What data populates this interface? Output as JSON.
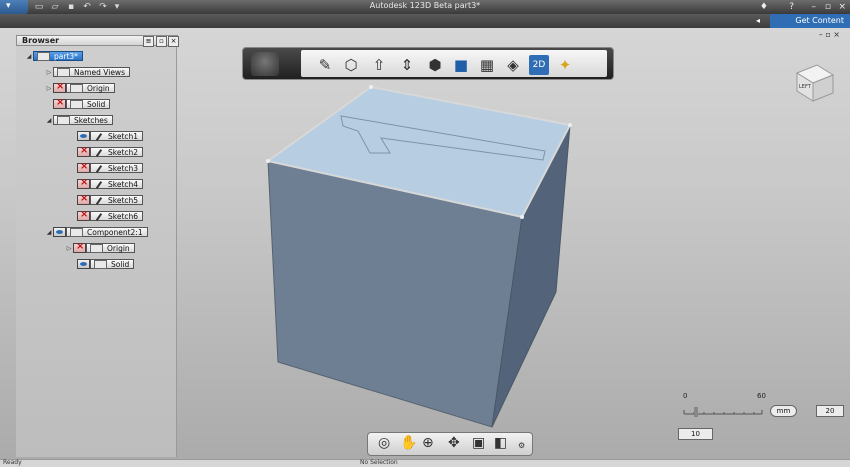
{
  "app": {
    "title": "Autodesk 123D Beta   part3*",
    "get_content": "Get Content"
  },
  "browser": {
    "title": "Browser",
    "tree": [
      {
        "label": "part3*",
        "selected": true
      },
      {
        "label": "Named Views"
      },
      {
        "label": "Origin"
      },
      {
        "label": "Solid"
      },
      {
        "label": "Sketches"
      },
      {
        "label": "Sketch1"
      },
      {
        "label": "Sketch2"
      },
      {
        "label": "Sketch3"
      },
      {
        "label": "Sketch4"
      },
      {
        "label": "Sketch5"
      },
      {
        "label": "Sketch6"
      },
      {
        "label": "Component2:1"
      },
      {
        "label": "Origin"
      },
      {
        "label": "Solid"
      }
    ]
  },
  "viewcube": {
    "face_label": "LEFT"
  },
  "scale": {
    "min": "0",
    "max": "60",
    "unit": "mm",
    "value": "10",
    "grid": "20"
  },
  "status": {
    "left": "Ready",
    "center": "No Selection"
  }
}
